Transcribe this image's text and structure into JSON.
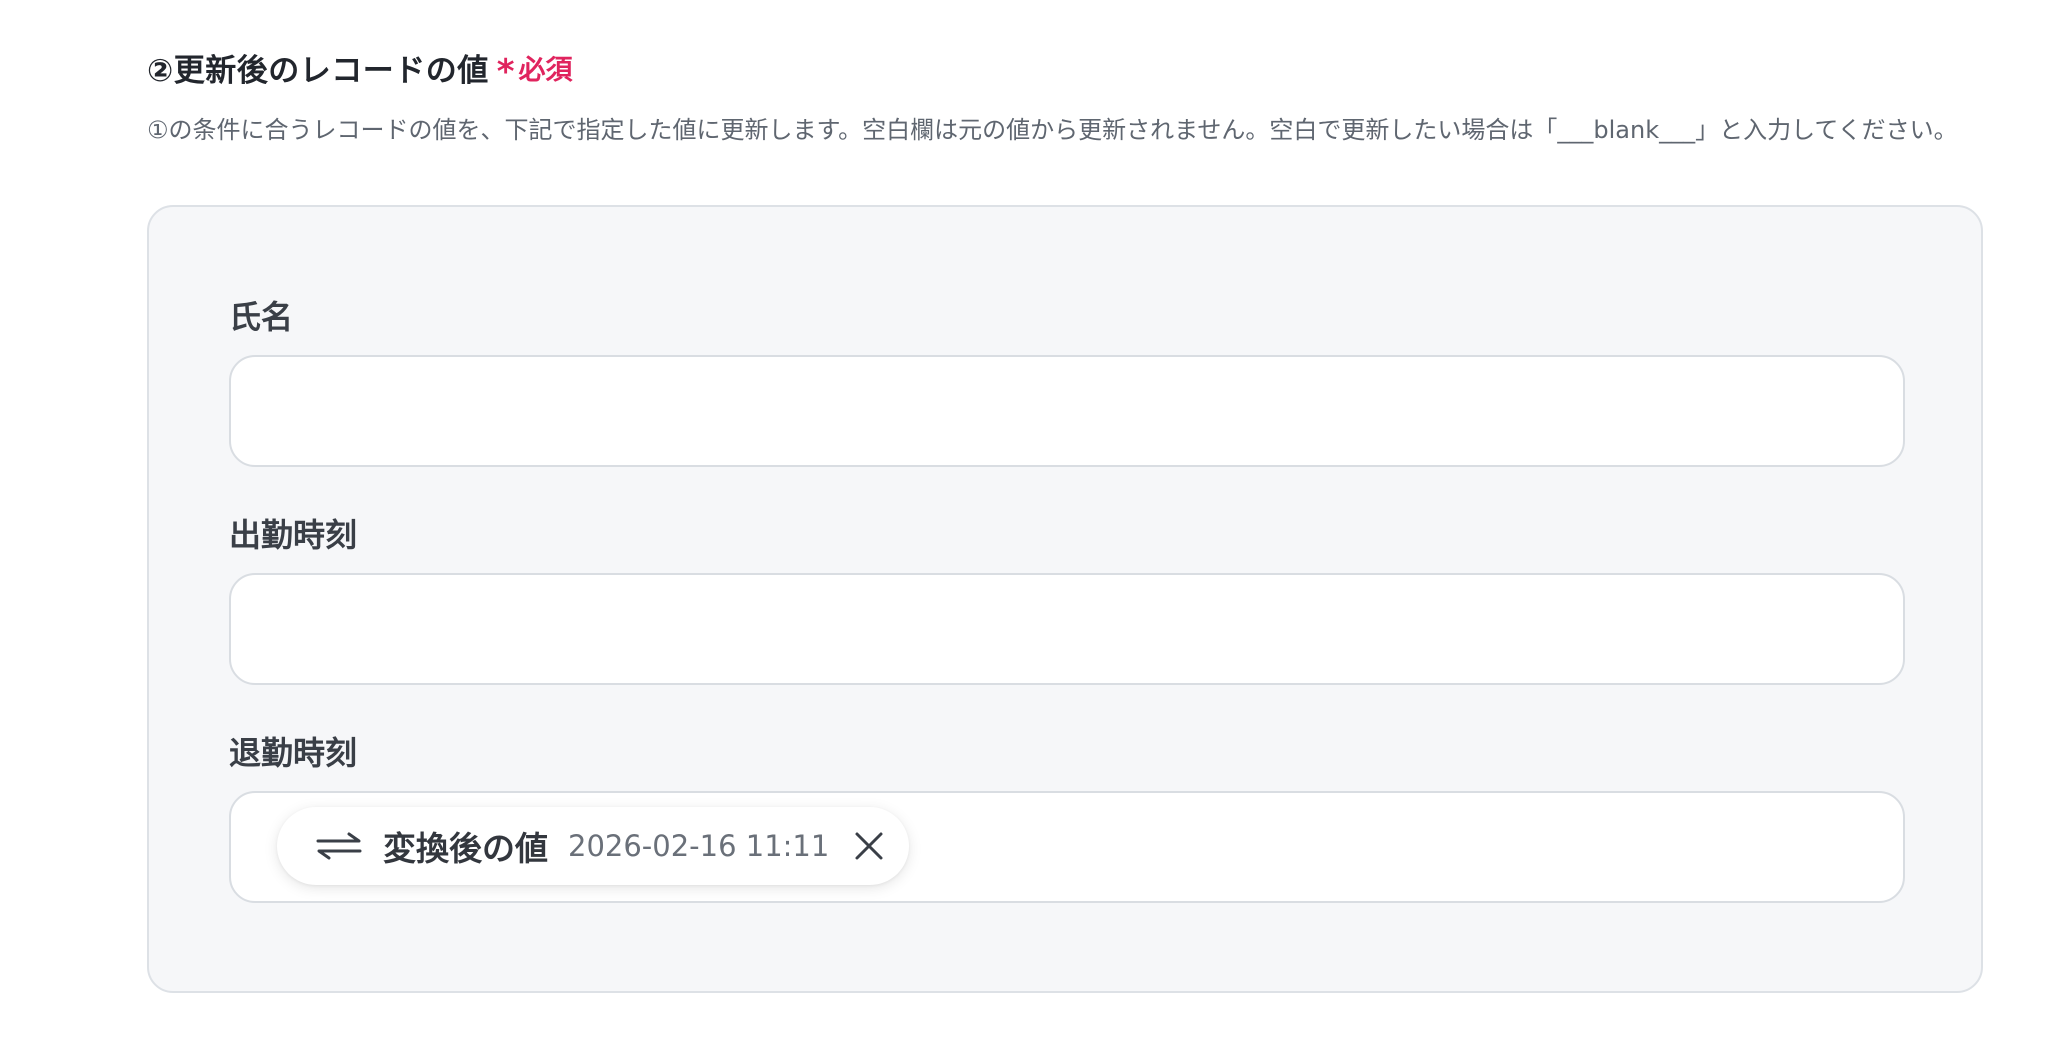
{
  "section": {
    "title": "②更新後のレコードの値",
    "required_asterisk": "*",
    "required_label": "必須",
    "description": "①の条件に合うレコードの値を、下記で指定した値に更新します。空白欄は元の値から更新されません。空白で更新したい場合は「___blank___」と入力してください。"
  },
  "fields": [
    {
      "label": "氏名",
      "value": ""
    },
    {
      "label": "出勤時刻",
      "value": ""
    },
    {
      "label": "退勤時刻",
      "chip": {
        "icon": "swap-arrows-icon",
        "label": "変換後の値",
        "value": "2026-02-16 11:11",
        "close_icon": "close-icon"
      }
    }
  ],
  "colors": {
    "required": "#e0245e",
    "panel_bg": "#f6f7f9",
    "input_border": "#d9dde2"
  }
}
